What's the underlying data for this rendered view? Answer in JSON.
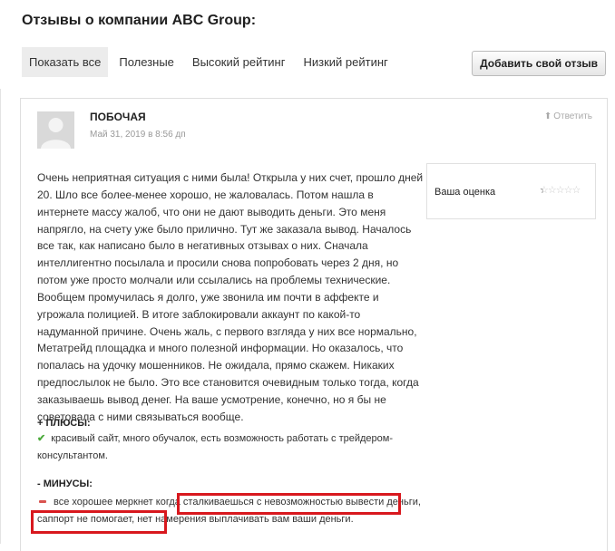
{
  "page": {
    "title": "Отзывы о компании ABC Group:"
  },
  "filters": [
    {
      "label": "Показать все",
      "active": true
    },
    {
      "label": "Полезные",
      "active": false
    },
    {
      "label": "Высокий рейтинг",
      "active": false
    },
    {
      "label": "Низкий рейтинг",
      "active": false
    }
  ],
  "add_review_label": "Добавить свой отзыв",
  "review": {
    "author": "ПОБОЧАЯ",
    "date": "Май 31, 2019 в 8:56 дп",
    "reply_label": "Ответить",
    "reply_icon": "arrow-up-icon",
    "text": "Очень неприятная ситуация с ними была! Открыла у них счет, прошло дней 20. Шло все более-менее хорошо, не жаловалась. Потом нашла в интернете массу жалоб, что они не дают выводить деньги. Это меня напрягло, на счету уже было прилично. Тут же заказала вывод. Началось все так, как написано было в негативных отзывах о них. Сначала интеллигентно посылала и просили снова попробовать через 2 дня, но потом уже просто молчали или ссылались на проблемы технические. Вообщем промучилась я долго, уже звонила им почти в аффекте и угрожала полицией. В итоге заблокировали аккаунт по какой-то надуманной причине. Очень жаль, с первого взгляда у них все нормально, Метатрейд площадка и много полезной информации. Но оказалось, что попалась на удочку мошенников. Не ожидала, прямо скажем. Никаких предпослылок не было. Это все становится очевидным только тогда, когда заказываешь вывод денег. На ваше усмотрение, конечно, но я бы не советовала с ними связываться вообще.",
    "rating_label": "Ваша оценка",
    "rating_value": 0.5,
    "rating_max": 5,
    "pros_heading": "+ ПЛЮСЫ:",
    "pros_text": "красивый сайт, много обучалок, есть возможность работать с трейдером-консультантом.",
    "cons_heading": "- МИНУСЫ:",
    "cons_text": "все хорошее меркнет когда сталкиваешься с невозможностью вывести деньги, саппорт не помогает, нет намерения выплачивать вам ваши деньги."
  },
  "colors": {
    "highlight": "#d8181e",
    "pros_check": "#4caa3c",
    "cons_minus": "#d9534f"
  }
}
